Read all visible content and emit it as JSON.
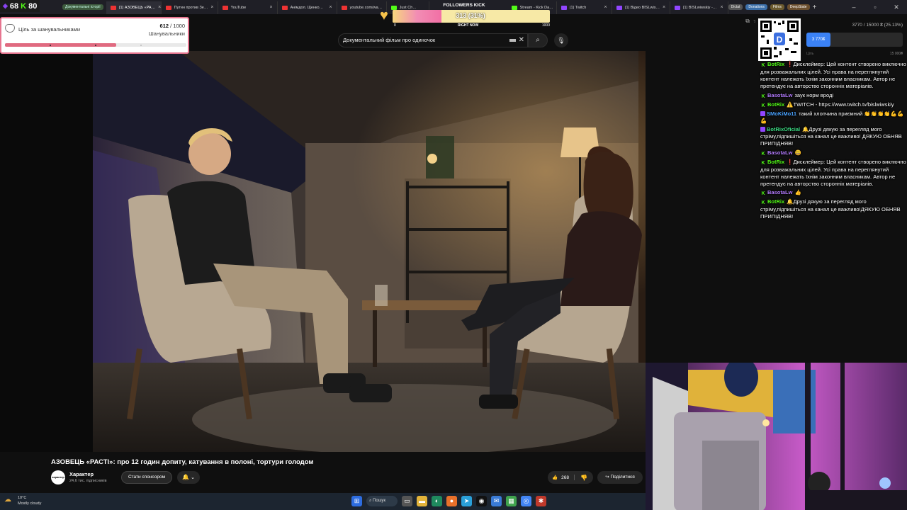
{
  "counter": {
    "value1": "68",
    "kick_value": "80"
  },
  "tabs": [
    {
      "label": "Документальні історії",
      "type": "pill"
    },
    {
      "label": "(1) АЗОВЕЦЬ «РА…",
      "type": "yt",
      "active": true
    },
    {
      "label": "Путин против Зе…",
      "type": "yt"
    },
    {
      "label": "YouTube",
      "type": "yt"
    },
    {
      "label": "Анімдол. Щенко…",
      "type": "yt"
    },
    {
      "label": "youtube.com/wa…",
      "type": "yt"
    },
    {
      "label": "Just Ch…",
      "type": "kk"
    },
    {
      "label": "Stream - Kick Da…",
      "type": "kk"
    },
    {
      "label": "(1) Twitch",
      "type": "tw"
    },
    {
      "label": "(1) Відео BISLwis…",
      "type": "tw"
    },
    {
      "label": "(1) BISLwiwskiy -…",
      "type": "tw"
    }
  ],
  "bookmarks": [
    "Dictat",
    "Donations",
    "Films",
    "DeepState"
  ],
  "follower_goal": {
    "title": "Ціль за шанувальниками",
    "current": "612",
    "target": "/ 1000",
    "label": "Шанувальники",
    "progress": 0.612
  },
  "followers_kick": {
    "title": "FOLLOWERS KICK",
    "value": "313 (31%)",
    "progress": 0.31,
    "min": "0",
    "mid": "RIGHT NOW",
    "max": "1000"
  },
  "search": {
    "query": "Документальний фільм  про одиночок"
  },
  "video": {
    "title": "АЗОВЕЦЬ «РАСТІ»: про 12 годин допиту, катування в полоні, тортури голодом",
    "channel": "Характер",
    "channel_avatar": "характер",
    "subscribers": "24,6 тис. підписників",
    "sponsor_label": "Стати спонсором",
    "likes": "268",
    "share_label": "Поділитися"
  },
  "donation": {
    "text": "3770 / 15000 ₴ (25.13%)",
    "fill_label": "3 770₴",
    "progress": 0.2513,
    "current_label": "Ціль",
    "target_label": "15 000₴"
  },
  "chat": [
    {
      "user": "BotRix",
      "color": "green",
      "badge": "K",
      "text": "❗Дисклеймер: Цей контент створено виключно для розважальних цілей. Усі права на переглянутий контент належать їхнім законним власникам. Автор не претендує на авторство сторонніх матеріалів."
    },
    {
      "user": "BasotaLw",
      "color": "purple",
      "badge": "K",
      "text": "заук норм вроді"
    },
    {
      "user": "BotRix",
      "color": "green",
      "badge": "K",
      "text": "⚠️TWITCH - https://www.twitch.tv/bislwiwskiy"
    },
    {
      "user": "SMoKiMo11",
      "color": "blue",
      "badge": "P",
      "text": "такий хлопчина приємний 👏👏👏👏💪💪💪"
    },
    {
      "user": "BotRixOficial",
      "color": "lime",
      "badge": "P",
      "text": "🔔Друзі дякую за перегляд мого стріму,підпишіться на канал це важливо! ДЯКУЮ ОБНЯВ ПРИПІДНЯВ!"
    },
    {
      "user": "BasotaLw",
      "color": "purple",
      "badge": "K",
      "text": "😃"
    },
    {
      "user": "BotRix",
      "color": "green",
      "badge": "K",
      "text": "❗Дисклеймер: Цей контент створено виключно для розважальних цілей. Усі права на переглянутий контент належать їхнім законним власникам. Автор не претендує на авторство сторонніх матеріалів."
    },
    {
      "user": "BasotaLw",
      "color": "purple",
      "badge": "K",
      "text": "👍"
    },
    {
      "user": "BotRix",
      "color": "green",
      "badge": "K",
      "text": "🔔Друзі дякую за перегляд мого стріму,підпишіться на канал це важливо!ДЯКУЮ ОБНЯВ ПРИПІДНЯВ!"
    }
  ],
  "taskbar": {
    "temp": "10°C",
    "weather": "Mostly cloudy",
    "search_label": "Пошук"
  },
  "colors": {
    "youtube_red": "#ff0000",
    "kick_green": "#53fc18",
    "twitch_purple": "#9146ff",
    "goal_pink": "#e06a80"
  }
}
